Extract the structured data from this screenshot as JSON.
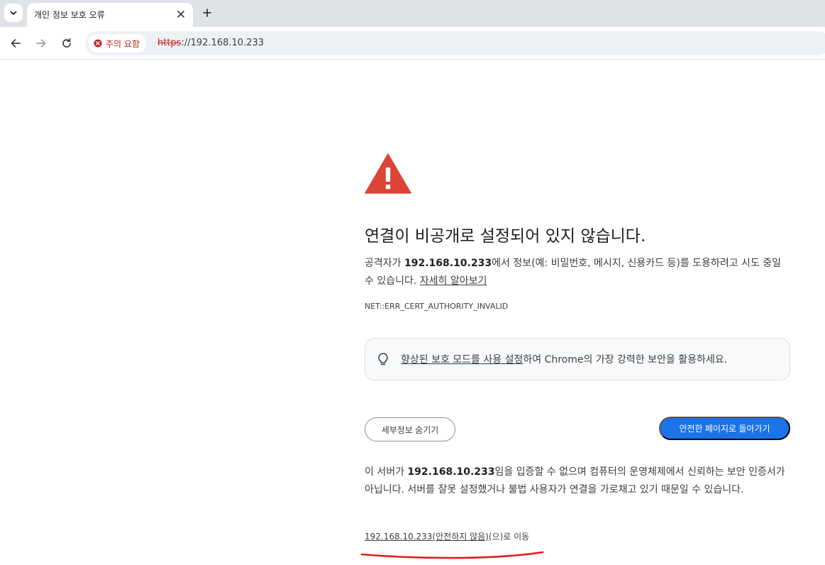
{
  "tabs": {
    "active_title": "개인 정보 보호 오류"
  },
  "toolbar": {
    "security_chip": "주의 요함",
    "url_scheme": "https",
    "url_rest": "://192.168.10.233"
  },
  "interstitial": {
    "heading": "연결이 비공개로 설정되어 있지 않습니다.",
    "desc_prefix": "공격자가 ",
    "host": "192.168.10.233",
    "desc_suffix": "에서 정보(예: 비밀번호, 메시지, 신용카드 등)를 도용하려고 시도 중일 수 있습니다. ",
    "learn_more": "자세히 알아보기",
    "error_code": "NET::ERR_CERT_AUTHORITY_INVALID",
    "enhanced_link": "향상된 보호 모드를 사용 설정",
    "enhanced_rest": "하여 Chrome의 가장 강력한 보안을 활용하세요.",
    "hide_details_button": "세부정보 숨기기",
    "back_button": "안전한 페이지로 돌아가기",
    "details_prefix": "이 서버가 ",
    "details_suffix": "임을 입증할 수 없으며 컴퓨터의 운영체제에서 신뢰하는 보안 인증서가 아닙니다. 서버를 잘못 설정했거나 불법 사용자가 연결을 가로채고 있기 때문일 수 있습니다.",
    "proceed_link": "192.168.10.233(안전하지 않음)",
    "proceed_suffix": "(으)로 이동"
  },
  "colors": {
    "accent": "#1a73e8",
    "warning": "#db4437",
    "annotation": "#e21b1b"
  }
}
